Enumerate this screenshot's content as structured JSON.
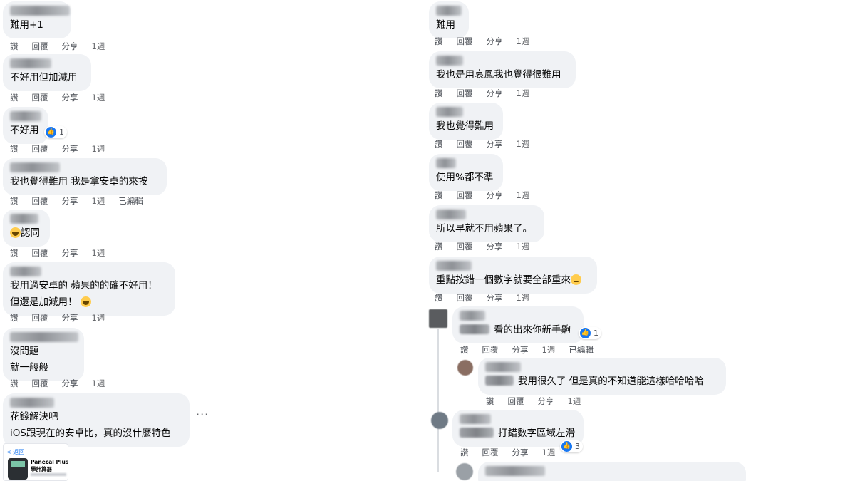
{
  "actions": {
    "like": "讚",
    "reply": "回覆",
    "share": "分享",
    "edited": "已編輯"
  },
  "left_comments": [
    {
      "text": "難用+1",
      "time": "1週"
    },
    {
      "text": "不好用但加減用",
      "time": "1週"
    },
    {
      "text": "不好用",
      "time": "1週",
      "likes": "1"
    },
    {
      "text": "我也覺得難用 我是拿安卓的來按",
      "time": "1週"
    },
    {
      "text": "認同",
      "time": "1週"
    },
    {
      "line1": "我用過安卓的 蘋果的的確不好用！",
      "line2": "但還是加減用！",
      "time": "1週"
    },
    {
      "line1": "沒問題",
      "line2": "就一般般",
      "time": "1週"
    },
    {
      "line1": "花錢解決吧",
      "line2": "iOS跟現在的安卓比，真的沒什麼特色"
    }
  ],
  "right_comments": [
    {
      "text": "難用",
      "time": "1週"
    },
    {
      "text": "我也是用哀鳳我也覺得很難用",
      "time": "1週"
    },
    {
      "text": "我也覺得難用",
      "time": "1週"
    },
    {
      "text": "使用%都不準",
      "time": "1週"
    },
    {
      "text": "所以早就不用蘋果了。",
      "time": "1週"
    },
    {
      "text": "重點按錯一個數字就要全部重來",
      "time": "1週"
    }
  ],
  "replies": [
    {
      "text": "看的出來你新手齁",
      "time": "1週",
      "likes": "1"
    },
    {
      "text": "我用很久了 但是真的不知道能這樣哈哈哈哈",
      "time": "1週"
    },
    {
      "text": "打錯數字區域左滑",
      "time": "1週",
      "likes": "3"
    }
  ],
  "more_menu": "···",
  "app_card": {
    "back_label": "< 返回",
    "title_line1": "Panecal Plus 科",
    "title_line2": "學計算器"
  },
  "colors": {
    "bubble": "#f0f2f5",
    "like_blue": "#1877f2",
    "action_text": "#4b4f56"
  }
}
